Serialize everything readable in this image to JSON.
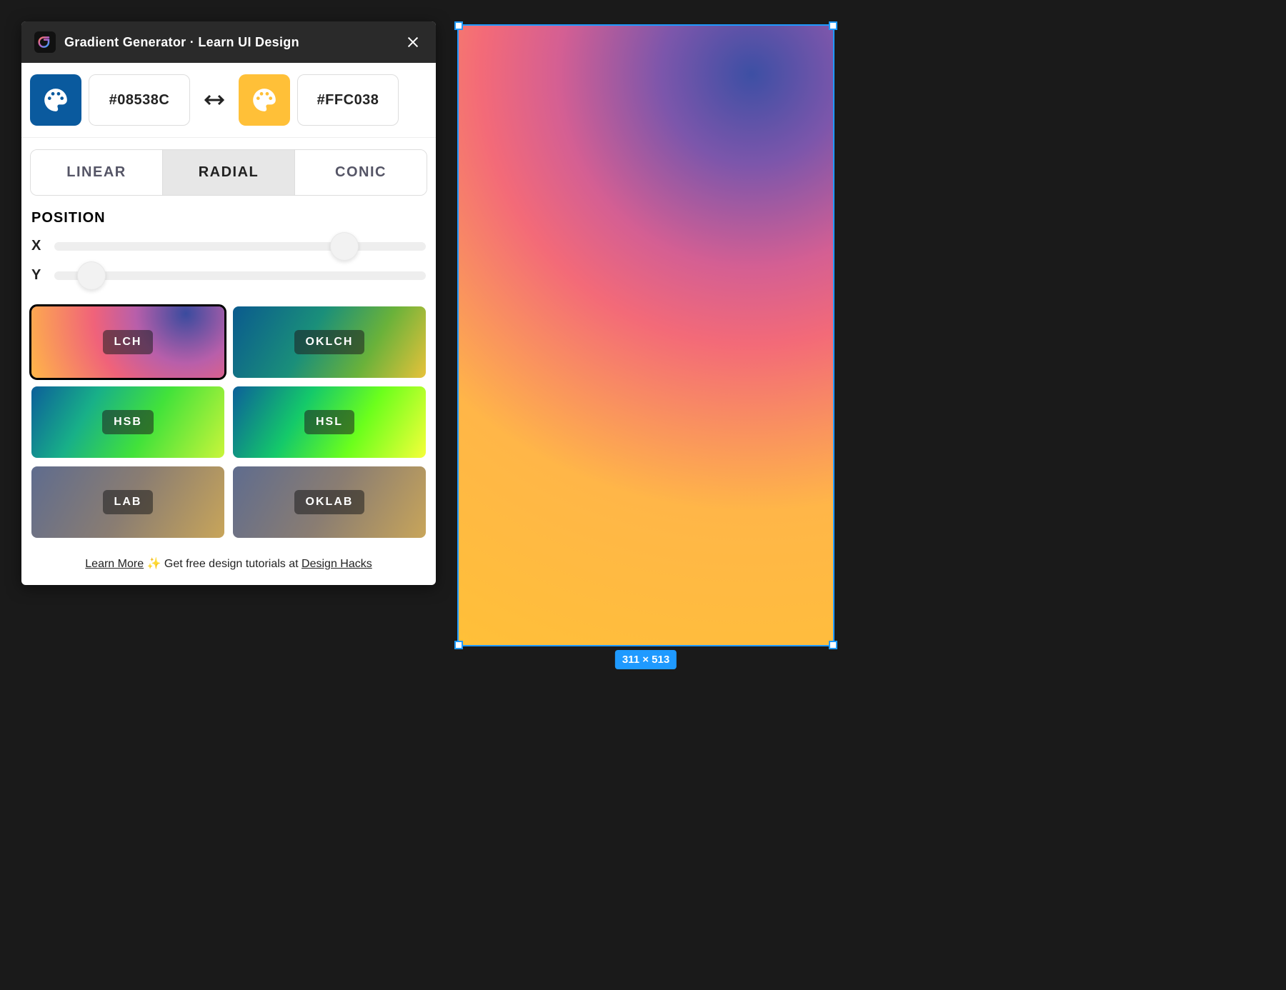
{
  "header": {
    "title": "Gradient Generator · Learn UI Design"
  },
  "colors": {
    "start_hex": "#08538C",
    "end_hex": "#FFC038",
    "start_swatch": "#0a5a9e",
    "end_swatch": "#ffc038"
  },
  "type_tabs": {
    "items": [
      "LINEAR",
      "RADIAL",
      "CONIC"
    ],
    "active": "RADIAL"
  },
  "position": {
    "label": "POSITION",
    "x_label": "X",
    "y_label": "Y",
    "x_value": 78,
    "y_value": 10
  },
  "spaces": {
    "items": [
      {
        "label": "LCH",
        "bg": "bg-lch",
        "selected": true
      },
      {
        "label": "OKLCH",
        "bg": "bg-oklch",
        "selected": false
      },
      {
        "label": "HSB",
        "bg": "bg-hsb",
        "selected": false
      },
      {
        "label": "HSL",
        "bg": "bg-hsl",
        "selected": false
      },
      {
        "label": "LAB",
        "bg": "bg-lab",
        "selected": false
      },
      {
        "label": "OKLAB",
        "bg": "bg-oklab",
        "selected": false
      }
    ]
  },
  "footer": {
    "learn_more": "Learn More",
    "sparkle": "✨",
    "cta_text": "Get free design tutorials at",
    "link_text": "Design Hacks"
  },
  "preview": {
    "dimensions_label": "311 × 513"
  }
}
